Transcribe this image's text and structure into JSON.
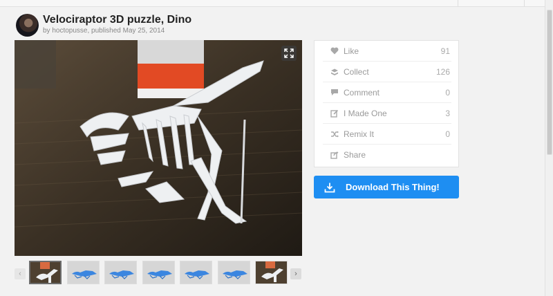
{
  "thing": {
    "title": "Velociraptor 3D puzzle, Dino",
    "byline": "by hoctopusse, published May 25, 2014"
  },
  "stats": [
    {
      "label": "Like",
      "count": "91",
      "icon": "heart-icon"
    },
    {
      "label": "Collect",
      "count": "126",
      "icon": "collect-icon"
    },
    {
      "label": "Comment",
      "count": "0",
      "icon": "comment-icon"
    },
    {
      "label": "I Made One",
      "count": "3",
      "icon": "made-one-icon"
    },
    {
      "label": "Remix It",
      "count": "0",
      "icon": "remix-icon"
    },
    {
      "label": "Share",
      "count": "",
      "icon": "share-icon"
    }
  ],
  "download": {
    "label": "Download This Thing!",
    "icon": "download-icon"
  },
  "thumbnails": [
    {
      "kind": "photo",
      "active": true
    },
    {
      "kind": "render",
      "active": false
    },
    {
      "kind": "render",
      "active": false
    },
    {
      "kind": "render",
      "active": false
    },
    {
      "kind": "render",
      "active": false
    },
    {
      "kind": "render",
      "active": false
    },
    {
      "kind": "photo",
      "active": false
    }
  ],
  "colors": {
    "accent": "#1e8ef2",
    "panel_bg": "#ffffff",
    "page_bg": "#f2f2f2"
  }
}
